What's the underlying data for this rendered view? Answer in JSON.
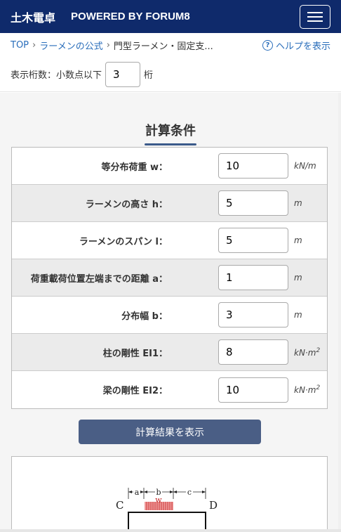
{
  "header": {
    "brand_jp": "土木電卓",
    "brand_en": "POWERED BY FORUM8"
  },
  "breadcrumb": {
    "top": "TOP",
    "level1": "ラーメンの公式",
    "current": "門型ラーメン・固定支...",
    "help": "ヘルプを表示"
  },
  "digits": {
    "label": "表示桁数：小数点以下",
    "value": "3",
    "suffix": "桁"
  },
  "section": {
    "title": "計算条件"
  },
  "rows": [
    {
      "label": "等分布荷重 w：",
      "value": "10",
      "unit": "kN/m"
    },
    {
      "label": "ラーメンの高さ h：",
      "value": "5",
      "unit": "m"
    },
    {
      "label": "ラーメンのスパン l：",
      "value": "5",
      "unit": "m"
    },
    {
      "label": "荷重載荷位置左端までの距離 a：",
      "value": "1",
      "unit": "m"
    },
    {
      "label": "分布幅 b：",
      "value": "3",
      "unit": "m"
    },
    {
      "label": "柱の剛性 EI1：",
      "value": "8",
      "unit": "kN·m",
      "unit_sup": "2"
    },
    {
      "label": "梁の剛性 EI2：",
      "value": "10",
      "unit": "kN·m",
      "unit_sup": "2"
    }
  ],
  "calc_button": "計算結果を表示",
  "diagram": {
    "dim_a": "a",
    "dim_b": "b",
    "dim_c": "c",
    "load": "w",
    "node_left": "C",
    "node_right": "D"
  }
}
